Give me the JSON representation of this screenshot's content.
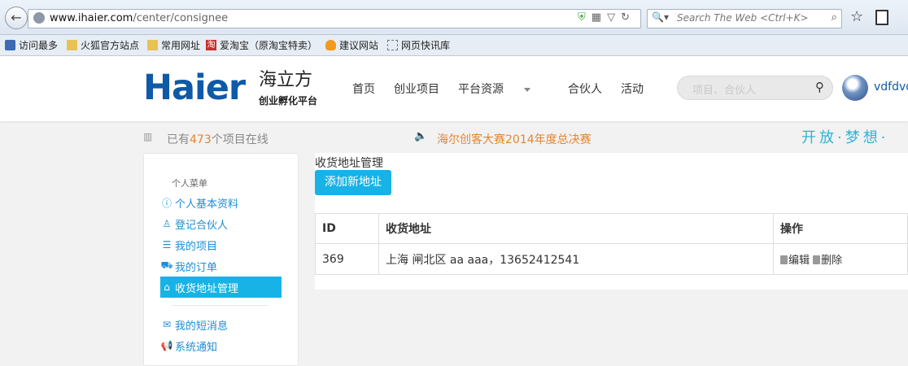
{
  "browser": {
    "url_host": "www.ihaier.com",
    "url_path": "/center/consignee",
    "search_placeholder": "Search The Web <Ctrl+K>",
    "bookmarks": [
      "访问最多",
      "火狐官方站点",
      "常用网址",
      "爱淘宝（原淘宝特卖）",
      "建议网站",
      "网页快讯库"
    ],
    "tao_badge": "淘"
  },
  "header": {
    "logo_text": "Haier",
    "logo_cn": "海立方",
    "logo_sub": "创业孵化平台",
    "nav": [
      "首页",
      "创业项目",
      "平台资源",
      "合伙人",
      "活动"
    ],
    "search_placeholder": "项目、合伙人",
    "username": "vdfdvd"
  },
  "info": {
    "stat_prefix": "已有",
    "stat_count": "473",
    "stat_suffix": "个项目在线",
    "notice": "海尔创客大赛2014年度总决赛",
    "slogan": "开放·梦想·"
  },
  "sidebar": {
    "title": "个人菜单",
    "items": [
      {
        "label": "个人基本资料",
        "icon": "info-icon"
      },
      {
        "label": "登记合伙人",
        "icon": "user-icon"
      },
      {
        "label": "我的项目",
        "icon": "list-icon"
      },
      {
        "label": "我的订单",
        "icon": "cart-icon"
      },
      {
        "label": "收货地址管理",
        "icon": "home-icon",
        "active": true
      },
      {
        "label": "我的短消息",
        "icon": "envelope-icon"
      },
      {
        "label": "系统通知",
        "icon": "bullhorn-icon"
      }
    ]
  },
  "main": {
    "title": "收货地址管理",
    "add_button": "添加新地址",
    "table": {
      "columns": [
        "ID",
        "收货地址",
        "操作"
      ],
      "rows": [
        {
          "id": "369",
          "address": "上海 闸北区 aa  aaa，13652412541",
          "edit": "编辑",
          "delete": "删除"
        }
      ]
    }
  },
  "colors": {
    "accent": "#17b3e6",
    "link": "#1c8ed6",
    "orange": "#e8842c",
    "brand": "#0e5aa7"
  }
}
